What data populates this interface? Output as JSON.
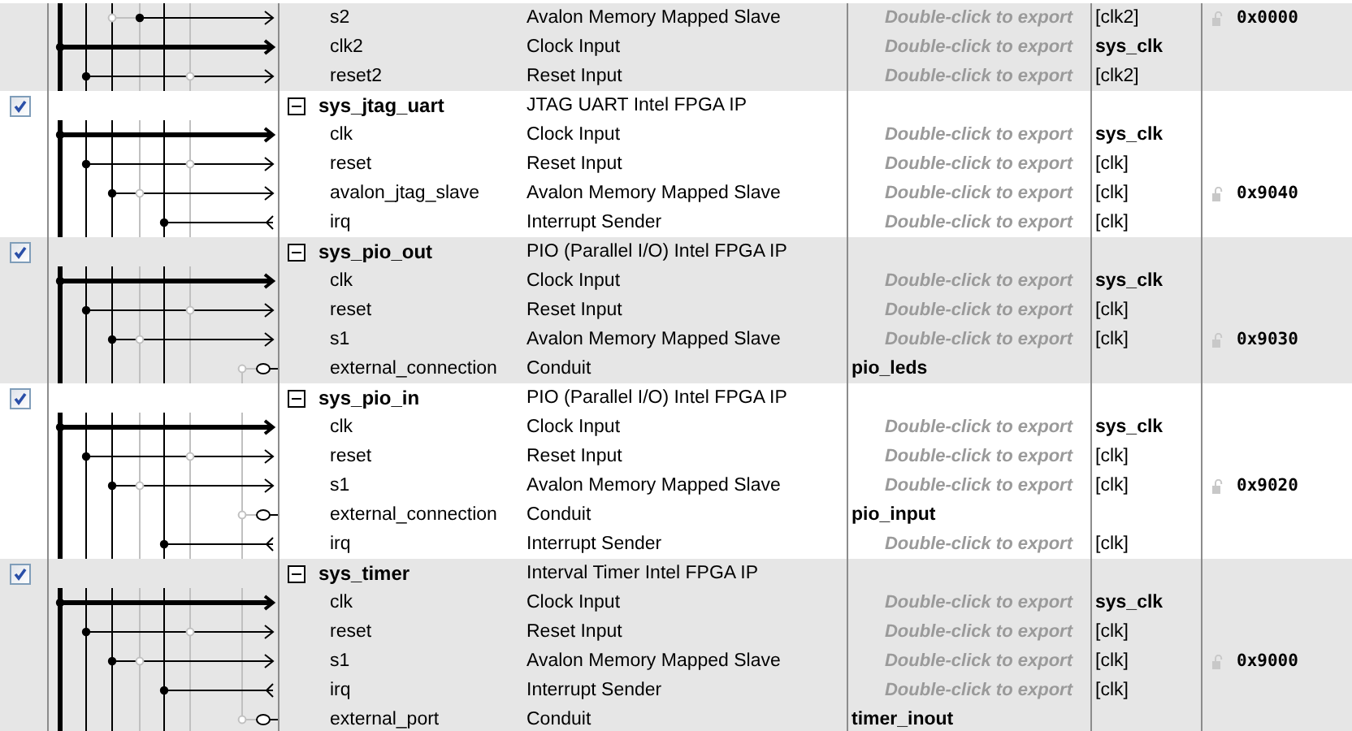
{
  "rows": [
    {
      "kind": "slave_alt",
      "name": "s2",
      "description": "Avalon Memory Mapped Slave",
      "export_hint": "Double-click to export",
      "clock": {
        "text": "[clk2]",
        "emphasized": false
      },
      "base": "0x0000",
      "shaded": true
    },
    {
      "kind": "clock",
      "name": "clk2",
      "description": "Clock Input",
      "export_hint": "Double-click to export",
      "clock": {
        "text": "sys_clk",
        "emphasized": true
      },
      "shaded": true
    },
    {
      "kind": "reset",
      "name": "reset2",
      "description": "Reset Input",
      "export_hint": "Double-click to export",
      "clock": {
        "text": "[clk2]",
        "emphasized": false
      },
      "shaded": true
    },
    {
      "kind": "module",
      "name": "sys_jtag_uart",
      "description": "JTAG UART Intel FPGA IP",
      "enabled": true,
      "expanded": true,
      "shaded": false
    },
    {
      "kind": "clock",
      "name": "clk",
      "description": "Clock Input",
      "export_hint": "Double-click to export",
      "clock": {
        "text": "sys_clk",
        "emphasized": true
      },
      "shaded": false
    },
    {
      "kind": "reset",
      "name": "reset",
      "description": "Reset Input",
      "export_hint": "Double-click to export",
      "clock": {
        "text": "[clk]",
        "emphasized": false
      },
      "shaded": false
    },
    {
      "kind": "slave",
      "name": "avalon_jtag_slave",
      "description": "Avalon Memory Mapped Slave",
      "export_hint": "Double-click to export",
      "clock": {
        "text": "[clk]",
        "emphasized": false
      },
      "base": "0x9040",
      "shaded": false
    },
    {
      "kind": "irq",
      "name": "irq",
      "description": "Interrupt Sender",
      "export_hint": "Double-click to export",
      "clock": {
        "text": "[clk]",
        "emphasized": false
      },
      "shaded": false
    },
    {
      "kind": "module",
      "name": "sys_pio_out",
      "description": "PIO (Parallel I/O) Intel FPGA IP",
      "enabled": true,
      "expanded": true,
      "shaded": true
    },
    {
      "kind": "clock",
      "name": "clk",
      "description": "Clock Input",
      "export_hint": "Double-click to export",
      "clock": {
        "text": "sys_clk",
        "emphasized": true
      },
      "shaded": true
    },
    {
      "kind": "reset",
      "name": "reset",
      "description": "Reset Input",
      "export_hint": "Double-click to export",
      "clock": {
        "text": "[clk]",
        "emphasized": false
      },
      "shaded": true
    },
    {
      "kind": "slave",
      "name": "s1",
      "description": "Avalon Memory Mapped Slave",
      "export_hint": "Double-click to export",
      "clock": {
        "text": "[clk]",
        "emphasized": false
      },
      "base": "0x9030",
      "shaded": true
    },
    {
      "kind": "conduit",
      "name": "external_connection",
      "description": "Conduit",
      "export": "pio_leds",
      "shaded": true
    },
    {
      "kind": "module",
      "name": "sys_pio_in",
      "description": "PIO (Parallel I/O) Intel FPGA IP",
      "enabled": true,
      "expanded": true,
      "shaded": false
    },
    {
      "kind": "clock",
      "name": "clk",
      "description": "Clock Input",
      "export_hint": "Double-click to export",
      "clock": {
        "text": "sys_clk",
        "emphasized": true
      },
      "shaded": false
    },
    {
      "kind": "reset",
      "name": "reset",
      "description": "Reset Input",
      "export_hint": "Double-click to export",
      "clock": {
        "text": "[clk]",
        "emphasized": false
      },
      "shaded": false
    },
    {
      "kind": "slave",
      "name": "s1",
      "description": "Avalon Memory Mapped Slave",
      "export_hint": "Double-click to export",
      "clock": {
        "text": "[clk]",
        "emphasized": false
      },
      "base": "0x9020",
      "shaded": false
    },
    {
      "kind": "conduit",
      "name": "external_connection",
      "description": "Conduit",
      "export": "pio_input",
      "shaded": false
    },
    {
      "kind": "irq",
      "name": "irq",
      "description": "Interrupt Sender",
      "export_hint": "Double-click to export",
      "clock": {
        "text": "[clk]",
        "emphasized": false
      },
      "shaded": false
    },
    {
      "kind": "module",
      "name": "sys_timer",
      "description": "Interval Timer Intel FPGA IP",
      "enabled": true,
      "expanded": true,
      "shaded": true
    },
    {
      "kind": "clock",
      "name": "clk",
      "description": "Clock Input",
      "export_hint": "Double-click to export",
      "clock": {
        "text": "sys_clk",
        "emphasized": true
      },
      "shaded": true
    },
    {
      "kind": "reset",
      "name": "reset",
      "description": "Reset Input",
      "export_hint": "Double-click to export",
      "clock": {
        "text": "[clk]",
        "emphasized": false
      },
      "shaded": true
    },
    {
      "kind": "slave",
      "name": "s1",
      "description": "Avalon Memory Mapped Slave",
      "export_hint": "Double-click to export",
      "clock": {
        "text": "[clk]",
        "emphasized": false
      },
      "base": "0x9000",
      "shaded": true
    },
    {
      "kind": "irq",
      "name": "irq",
      "description": "Interrupt Sender",
      "export_hint": "Double-click to export",
      "clock": {
        "text": "[clk]",
        "emphasized": false
      },
      "shaded": true
    },
    {
      "kind": "conduit",
      "name": "external_port",
      "description": "Conduit",
      "export": "timer_inout",
      "shaded": true
    }
  ]
}
